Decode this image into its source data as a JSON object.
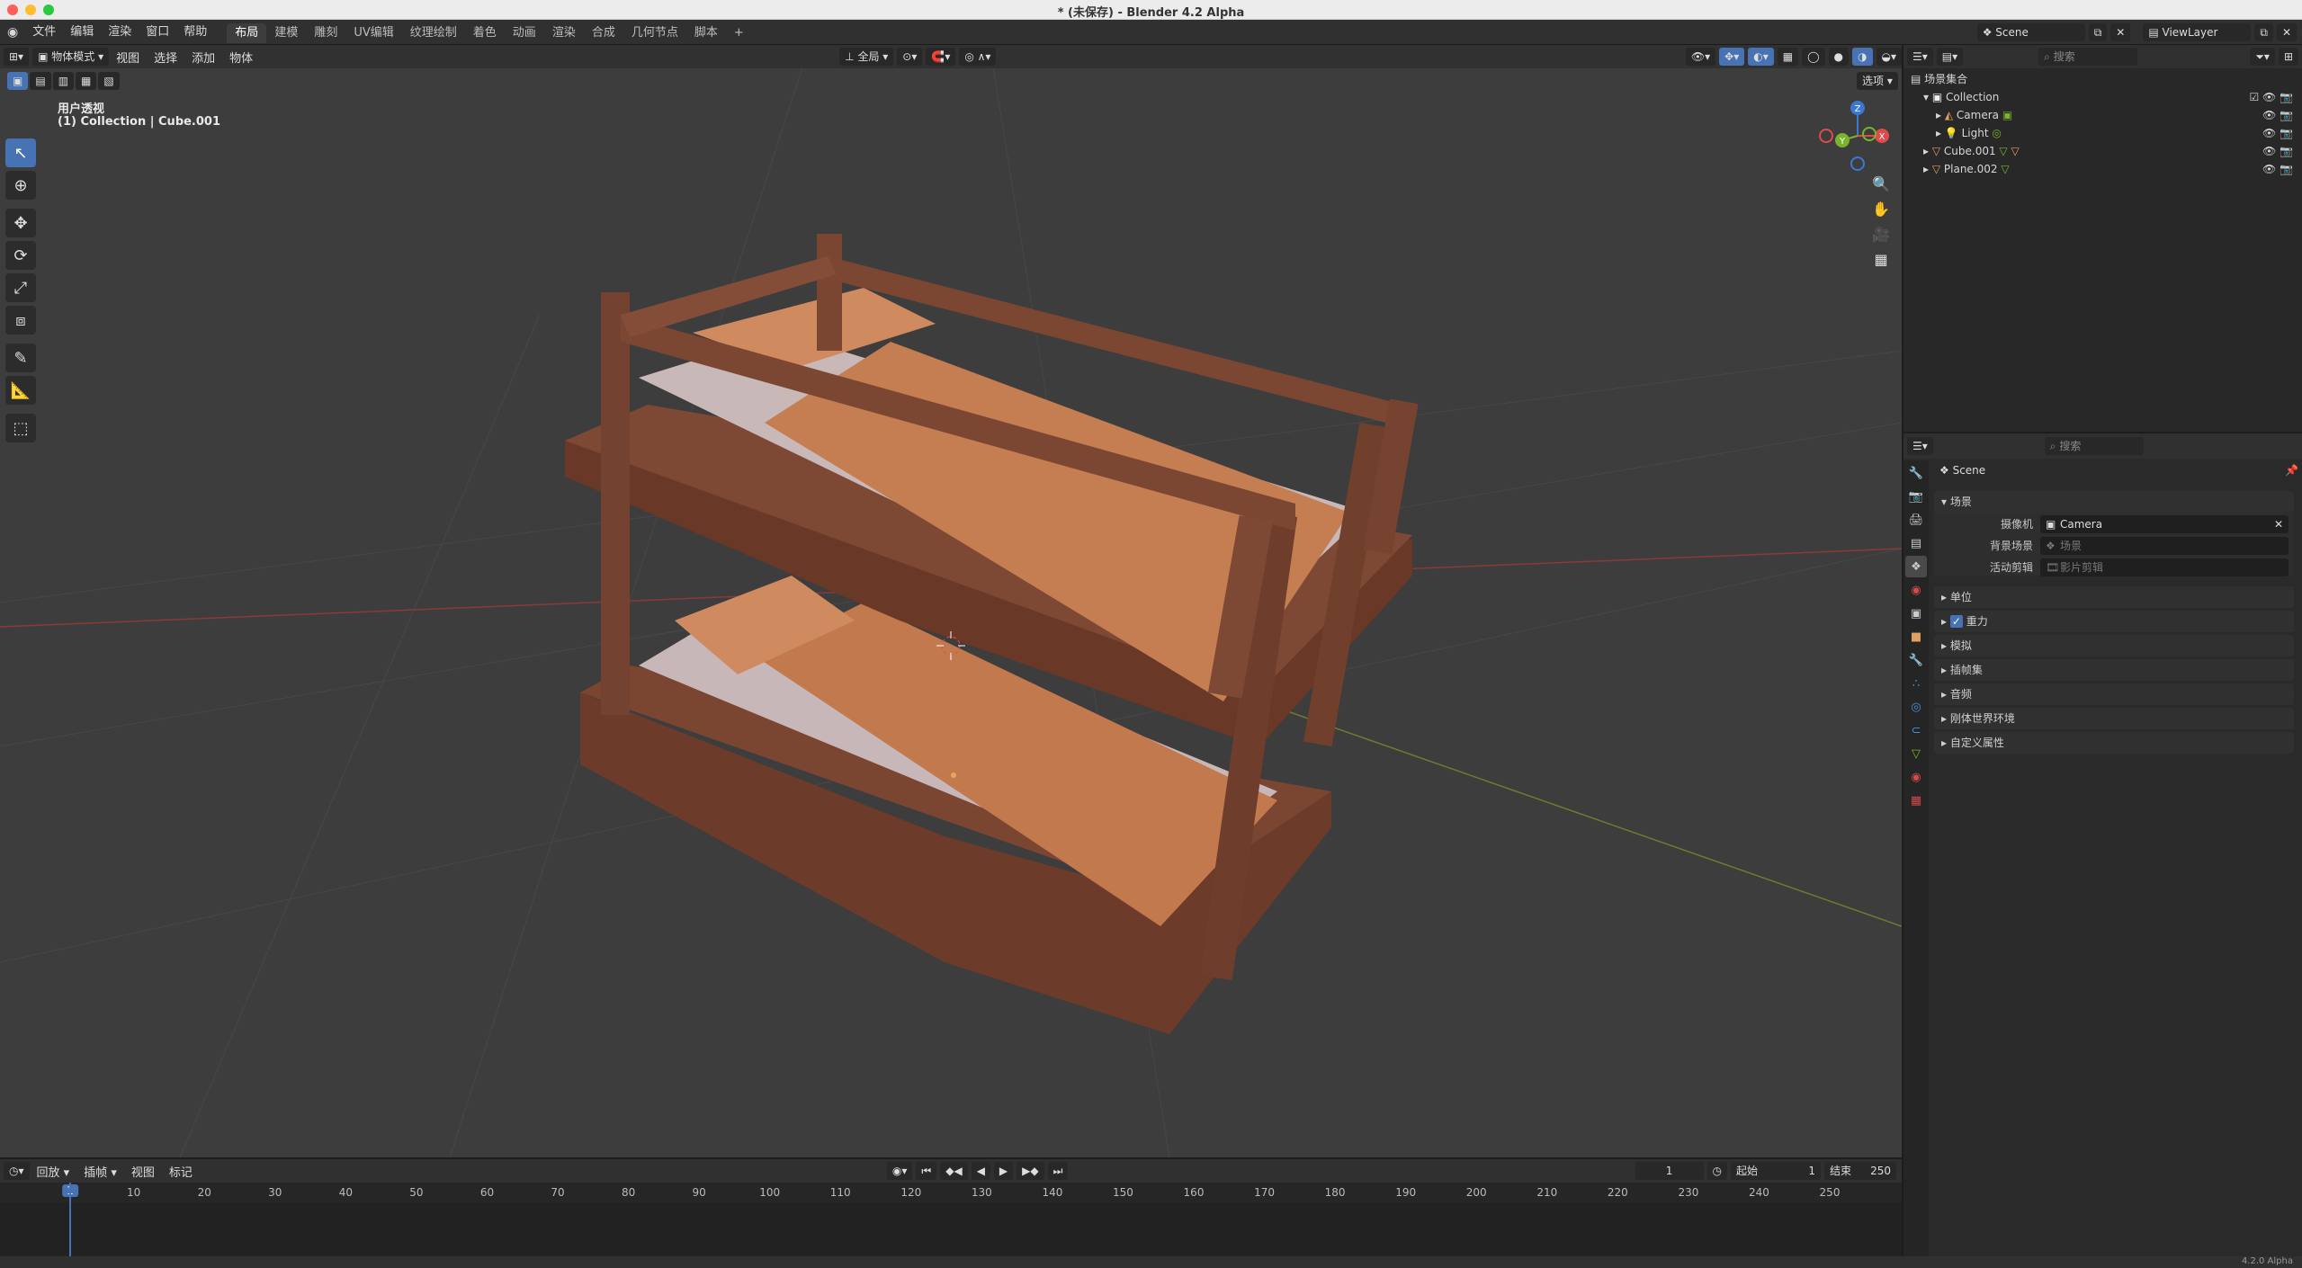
{
  "window": {
    "title": "* (未保存) - Blender 4.2 Alpha"
  },
  "topbar": {
    "menus": [
      "文件",
      "编辑",
      "渲染",
      "窗口",
      "帮助"
    ],
    "workspaces": [
      "布局",
      "建模",
      "雕刻",
      "UV编辑",
      "纹理绘制",
      "着色",
      "动画",
      "渲染",
      "合成",
      "几何节点",
      "脚本"
    ],
    "active_workspace": 0,
    "add_tab": "+",
    "scene": "Scene",
    "view_layer": "ViewLayer"
  },
  "viewport": {
    "mode": "物体模式",
    "menus": [
      "视图",
      "选择",
      "添加",
      "物体"
    ],
    "transform_orientation": "全局",
    "options_label": "选项",
    "view_name": "用户透视",
    "context": "(1) Collection | Cube.001",
    "gizmo": {
      "x": "X",
      "y": "Y",
      "z": "Z"
    }
  },
  "outliner": {
    "search_placeholder": "搜索",
    "root": "场景集合",
    "items": [
      {
        "name": "Collection",
        "indent": 1
      },
      {
        "name": "Camera",
        "indent": 2
      },
      {
        "name": "Light",
        "indent": 2
      },
      {
        "name": "Cube.001",
        "indent": 1
      },
      {
        "name": "Plane.002",
        "indent": 1
      }
    ]
  },
  "properties": {
    "search_placeholder": "搜索",
    "breadcrumb": "Scene",
    "section": "场景",
    "fields": [
      {
        "label": "摄像机",
        "value": "Camera",
        "placeholder": ""
      },
      {
        "label": "背景场景",
        "value": "",
        "placeholder": "场景"
      },
      {
        "label": "活动剪辑",
        "value": "",
        "placeholder": "影片剪辑"
      }
    ],
    "panels": [
      "单位",
      "重力",
      "模拟",
      "插帧集",
      "音频",
      "刚体世界环境",
      "自定义属性"
    ],
    "gravity_checked": true
  },
  "timeline": {
    "menus": [
      "回放",
      "插帧",
      "视图",
      "标记"
    ],
    "current_frame": "1",
    "start_label": "起始",
    "start": "1",
    "end_label": "结束",
    "end": "250",
    "ticks": [
      "1",
      "10",
      "20",
      "30",
      "40",
      "50",
      "60",
      "70",
      "80",
      "90",
      "100",
      "110",
      "120",
      "130",
      "140",
      "150",
      "160",
      "170",
      "180",
      "190",
      "200",
      "210",
      "220",
      "230",
      "240",
      "250"
    ]
  },
  "statusbar": {
    "version": "4.2.0 Alpha"
  },
  "colors": {
    "accent": "#4772b3",
    "x_axis": "#e04a4a",
    "y_axis": "#7ab32e",
    "z_axis": "#3b78d0",
    "wood": "#7a4632",
    "sheet": "#c98055"
  }
}
